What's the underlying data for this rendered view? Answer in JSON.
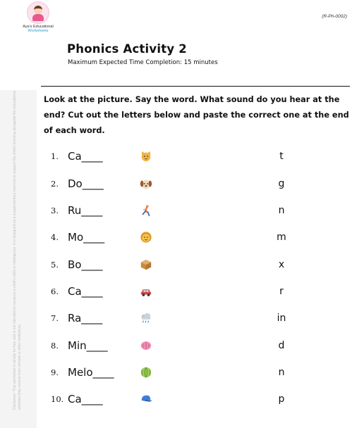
{
  "header": {
    "brand_line1": "Aya's Educational",
    "brand_line2": "Worksheets",
    "code": "(R-Ph-0002)",
    "title": "Phonics Activity 2",
    "subtitle": "Maximum Expected Time Completion: 15 minutes"
  },
  "side_note": "Disclaimer: This worksheet is strictly for free and is not intended to measure a child's skills or intelligence. It is designed as a supplementary exercise to support the child's learning alongside the educational activities they receive from schools or other institutions.",
  "instructions": "Look at the picture. Say the word. What sound do you hear at the end? Cut out the letters below and paste the correct one at the end of each word.",
  "items": [
    {
      "num": "1.",
      "word": "Ca____",
      "icon": "cat-icon",
      "letter": "t"
    },
    {
      "num": "2.",
      "word": "Do____",
      "icon": "dog-icon",
      "letter": "g"
    },
    {
      "num": "3.",
      "word": "Ru____",
      "icon": "runner-icon",
      "letter": "n"
    },
    {
      "num": "4.",
      "word": "Mo____",
      "icon": "face-icon",
      "letter": "m"
    },
    {
      "num": "5.",
      "word": "Bo____",
      "icon": "box-icon",
      "letter": "x"
    },
    {
      "num": "6.",
      "word": "Ca____",
      "icon": "car-icon",
      "letter": "r"
    },
    {
      "num": "7.",
      "word": "Ra____",
      "icon": "rain-cloud-icon",
      "letter": "in"
    },
    {
      "num": "8.",
      "word": "Min____",
      "icon": "brain-icon",
      "letter": "d"
    },
    {
      "num": "9.",
      "word": "Melo____",
      "icon": "melon-icon",
      "letter": "n"
    },
    {
      "num": "10.",
      "word": "Ca____",
      "icon": "cap-icon",
      "letter": "p"
    }
  ]
}
